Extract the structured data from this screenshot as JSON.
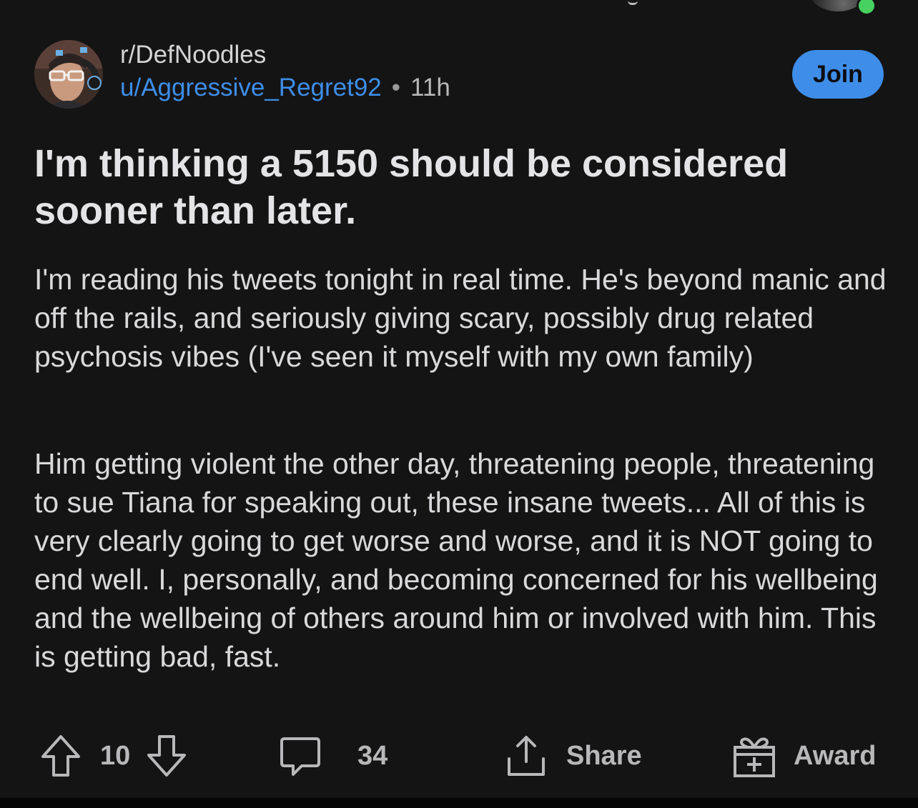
{
  "post": {
    "subreddit": "r/DefNoodles",
    "author": "u/Aggressive_Regret92",
    "separator": "•",
    "age": "11h",
    "join_label": "Join",
    "title": "I'm thinking a 5150 should be considered sooner than later.",
    "paragraphs": [
      "I'm reading his tweets tonight in real time. He's beyond manic and off the rails, and seriously giving scary, possibly drug related psychosis vibes (I've seen it myself with my own family)",
      "Him getting violent the other day, threatening people, threatening to sue Tiana for speaking out, these insane tweets... All of this is very clearly going to get worse and worse, and it is NOT going to end well. I, personally, and becoming concerned for his wellbeing and the wellbeing of others around him or involved with him. This is getting bad, fast."
    ]
  },
  "actions": {
    "votes": "10",
    "comments": "34",
    "share_label": "Share",
    "award_label": "Award"
  },
  "colors": {
    "background": "#141414",
    "accent": "#3e8ee9",
    "username": "#3d8ee8",
    "online": "#46d160",
    "text": "#d9d9db"
  },
  "icons": [
    "upvote-icon",
    "downvote-icon",
    "comment-icon",
    "share-icon",
    "award-icon"
  ]
}
